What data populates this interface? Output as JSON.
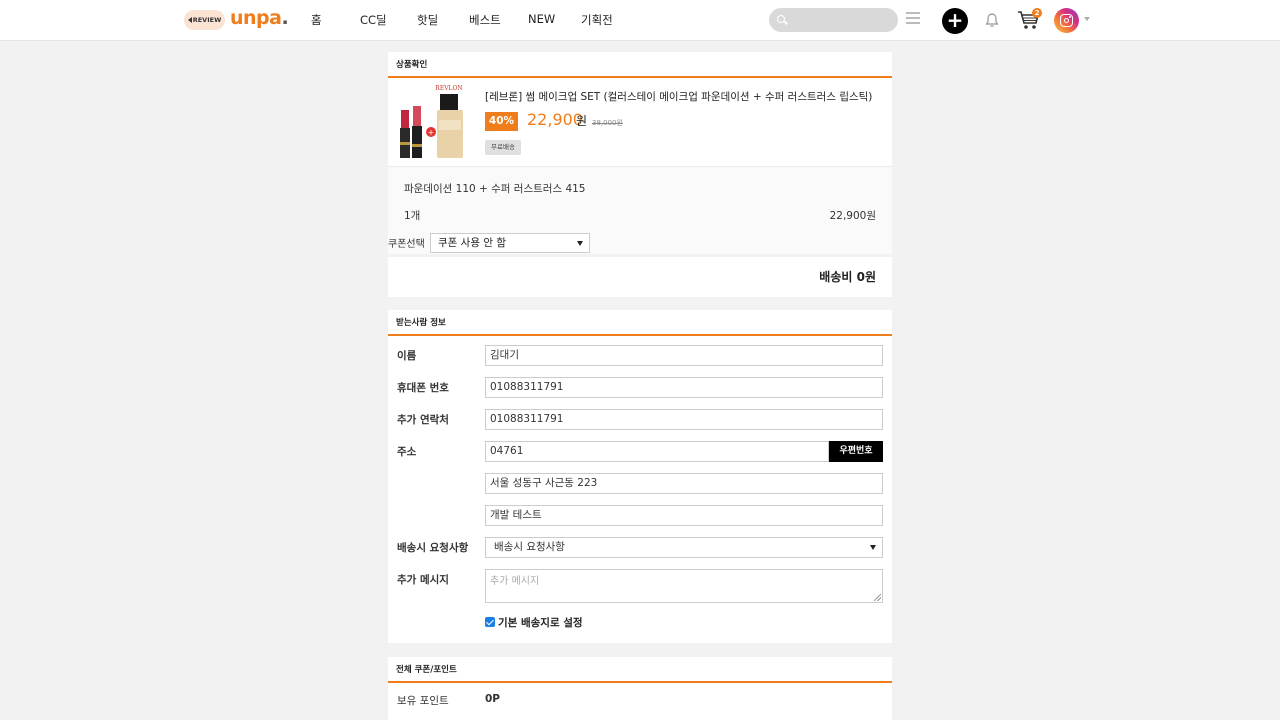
{
  "header": {
    "review_badge": "REVIEW",
    "logo_text": "unpa",
    "logo_dot": ".",
    "nav": [
      "홈",
      "CC딜",
      "핫딜",
      "베스트",
      "NEW",
      "기획전"
    ],
    "search_placeholder": "",
    "cart_count": "2",
    "icons": [
      "search-icon",
      "menu-icon",
      "plus-icon",
      "bell-icon",
      "cart-icon",
      "instagram-avatar-icon"
    ]
  },
  "product_section": {
    "title": "상품확인",
    "product_name": "[레브론] 썸 메이크업 SET (컬러스테이 메이크업 파운데이션 + 수퍼 러스트러스 립스틱)",
    "discount": "40%",
    "price": "22,900",
    "price_unit": "원",
    "original_price": "38,000원",
    "free_shipping": "무료배송",
    "image_brand_text": "REVLON",
    "option": "파운데이션 110 + 수퍼 러스트러스 415",
    "quantity": "1개",
    "subtotal": "22,900원",
    "coupon_label": "쿠폰선택",
    "coupon_selected": "쿠폰 사용 안 함",
    "shipping_fee": "배송비 0원"
  },
  "recipient_section": {
    "title": "받는사람 정보",
    "name_label": "이름",
    "name_value": "김대기",
    "phone_label": "휴대폰 번호",
    "phone_value": "01088311791",
    "extra_contact_label": "추가 연락처",
    "extra_contact_value": "01088311791",
    "address_label": "주소",
    "zipcode_value": "04761",
    "zipcode_button": "우편번호",
    "address1_value": "서울 성동구 사근동 223",
    "address2_value": "개발 테스트",
    "delivery_request_label": "배송시 요청사항",
    "delivery_request_selected": "배송시 요청사항",
    "extra_message_label": "추가 메시지",
    "extra_message_placeholder": "추가 메시지",
    "default_address_label": "기본 배송지로 설정",
    "default_address_checked": true
  },
  "points_section": {
    "title": "전체 쿠폰/포인트",
    "points_label": "보유 포인트",
    "points_value": "0P"
  },
  "colors": {
    "accent": "#f07d1b",
    "background": "#f2f2f2",
    "checkbox": "#1a7fe5"
  }
}
